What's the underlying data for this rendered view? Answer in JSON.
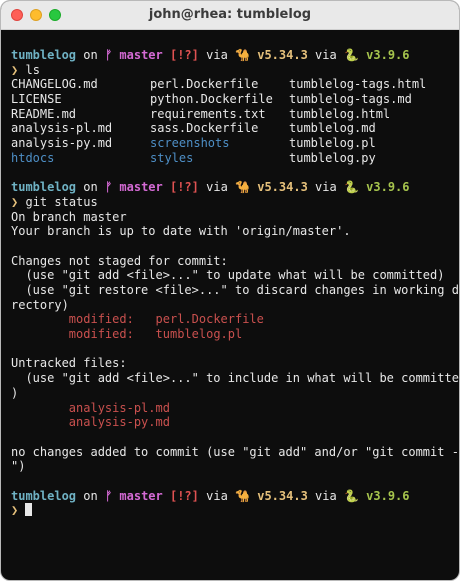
{
  "window": {
    "title": "john@rhea: tumblelog"
  },
  "prompt": {
    "dir": "tumblelog",
    "on": "on",
    "branch_icon": "ᚠ",
    "branch": "master",
    "status": "[!?]",
    "via": "via",
    "camel_icon": "🐪",
    "perl": "v5.34.3",
    "snake_icon": "🐍",
    "python": "v3.9.6",
    "chevron": "❯"
  },
  "cmd1": "ls",
  "ls_rows": [
    [
      "CHANGELOG.md",
      "perl.Dockerfile",
      "tumblelog-tags.html"
    ],
    [
      "LICENSE",
      "python.Dockerfile",
      "tumblelog-tags.md"
    ],
    [
      "README.md",
      "requirements.txt",
      "tumblelog.html"
    ],
    [
      "analysis-pl.md",
      "sass.Dockerfile",
      "tumblelog.md"
    ],
    [
      "analysis-py.md",
      "screenshots",
      "tumblelog.pl"
    ],
    [
      "htdocs",
      "styles",
      "tumblelog.py"
    ]
  ],
  "cmd2": "git status",
  "git": {
    "line1": "On branch master",
    "line2": "Your branch is up to date with 'origin/master'.",
    "changes_header": "Changes not staged for commit:",
    "hint1": "  (use \"git add <file>...\" to update what will be committed)",
    "hint2a": "  (use \"git restore <file>...\" to discard changes in working di",
    "hint2b": "rectory)",
    "mod_label": "modified:",
    "mod1": "perl.Dockerfile",
    "mod2": "tumblelog.pl",
    "untracked_header": "Untracked files:",
    "hint3a": "  (use \"git add <file>...\" to include in what will be committed",
    "hint3b": ")",
    "untracked1": "analysis-pl.md",
    "untracked2": "analysis-py.md",
    "final_a": "no changes added to commit (use \"git add\" and/or \"git commit -a",
    "final_b": "\")"
  }
}
